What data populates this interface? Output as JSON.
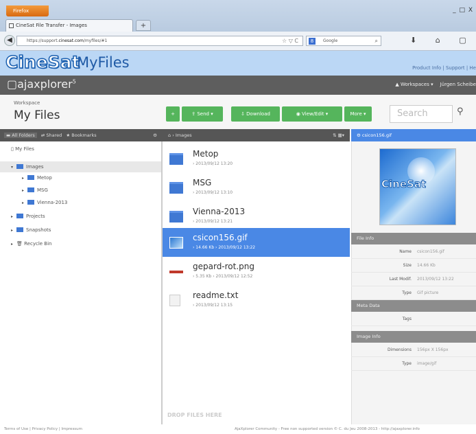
{
  "browser": {
    "menu_label": "Firefox",
    "tab_title": "CineSat File Transfer - Images",
    "new_tab": "+",
    "window_controls": "_ □ X",
    "url_prefix": "https://support.",
    "url_host": "cinesat.com",
    "url_path": "/myfiles/#1",
    "url_icons": "☆ ▽ C",
    "search_engine": "Google",
    "search_icon": "⌕",
    "nav_icons": "⬇ ⌂ ▢"
  },
  "app": {
    "logo_cinesat": "CineSat",
    "logo_myfiles": "MyFiles",
    "product_links": "Product Info | Support | He",
    "ajax_logo": "ajaxplorer",
    "ajax_version": "5",
    "workspaces": "Workspaces ▾",
    "user": "Jürgen Scheibe"
  },
  "workspace": {
    "label": "Workspace",
    "title": "My Files"
  },
  "toolbar": {
    "add": "+",
    "send": "Send ▾",
    "download": "Download",
    "view_edit": "View/Edit ▾",
    "more": "More ▾",
    "search_placeholder": "Search",
    "search_icon": "⚲"
  },
  "left_header": {
    "all_folders": "All Folders",
    "shared": "Shared",
    "bookmarks": "Bookmarks",
    "gear": "⚙"
  },
  "tree": [
    {
      "label": "My Files"
    },
    {
      "label": "Images"
    },
    {
      "label": "Metop"
    },
    {
      "label": "MSG"
    },
    {
      "label": "Vienna-2013"
    },
    {
      "label": "Projects"
    },
    {
      "label": "Snapshots"
    },
    {
      "label": "Recycle Bin"
    }
  ],
  "mid_header": {
    "breadcrumb": "Images",
    "controls": "⇅ ▦▾"
  },
  "files": [
    {
      "name": "Metop",
      "meta": "› 2013/09/12 13:20"
    },
    {
      "name": "MSG",
      "meta": "› 2013/09/12 13:10"
    },
    {
      "name": "Vienna-2013",
      "meta": "› 2013/09/12 13:21"
    },
    {
      "name": "csicon156.gif",
      "meta": "› 14.66 Kb › 2013/09/12 13:22"
    },
    {
      "name": "gepard-rot.png",
      "meta": "› 5.35 Kb › 2013/09/12 12:52"
    },
    {
      "name": "readme.txt",
      "meta": "› 2013/09/12 13:15"
    }
  ],
  "drop_text": "DROP FILES HERE",
  "right_header": {
    "filename": "csicon156.gif"
  },
  "preview": {
    "logo": "CineSat"
  },
  "file_info": {
    "title": "File Info",
    "name_label": "Name",
    "name": "csicon156.gif",
    "size_label": "Size",
    "size": "14.66 Kb",
    "modif_label": "Last Modif.",
    "modif": "2013/09/12 13:22",
    "type_label": "Type",
    "type": "Gif picture"
  },
  "meta_data": {
    "title": "Meta Data",
    "tags_label": "Tags"
  },
  "image_info": {
    "title": "Image Info",
    "dim_label": "Dimensions",
    "dim": "156px X 156px",
    "type_label": "Type",
    "type": "image/gif"
  },
  "footer": {
    "left": "Terms of Use | Privacy Policy | Impressum",
    "right": "AjaXplorer Community - Free non supported version © C. du Jeu 2008-2013 - http://ajaxplorer.info"
  }
}
